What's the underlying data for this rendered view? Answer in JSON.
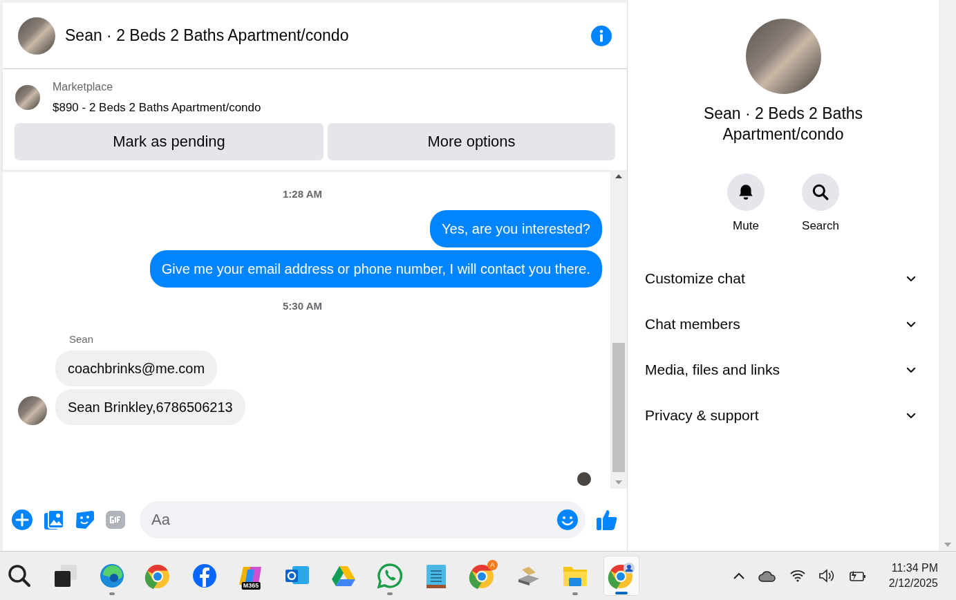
{
  "chat": {
    "title": "Sean · 2 Beds 2 Baths Apartment/condo",
    "listing": {
      "source": "Marketplace",
      "name": "$890 - 2 Beds 2 Baths Apartment/condo"
    },
    "actions": [
      "Mark as pending",
      "More options"
    ],
    "messages": [
      {
        "kind": "time",
        "text": "1:28 AM"
      },
      {
        "kind": "out",
        "text": "Yes, are you interested?"
      },
      {
        "kind": "out",
        "text": "Give me your email address or phone number, I will contact you there."
      },
      {
        "kind": "time",
        "text": "5:30 AM"
      },
      {
        "kind": "sender",
        "text": "Sean"
      },
      {
        "kind": "in",
        "text": "coachbrinks@me.com",
        "avatar": false
      },
      {
        "kind": "in",
        "text": "Sean Brinkley,6786506213",
        "avatar": true
      }
    ],
    "composer": {
      "placeholder": "Aa"
    }
  },
  "info": {
    "title": "Sean · 2 Beds 2 Baths Apartment/condo",
    "actions": [
      {
        "kind": "bell",
        "label": "Mute"
      },
      {
        "kind": "search",
        "label": "Search"
      }
    ],
    "sections": [
      {
        "label": "Customize chat",
        "expanded": false
      },
      {
        "label": "Chat members",
        "expanded": false
      },
      {
        "label": "Media, files and links",
        "expanded": false
      },
      {
        "label": "Privacy & support",
        "expanded": false
      }
    ]
  },
  "taskbar": {
    "apps": [
      {
        "kind": "search",
        "running": false,
        "selected": false
      },
      {
        "kind": "taskview",
        "running": false,
        "selected": false
      },
      {
        "kind": "edge",
        "running": true,
        "selected": false
      },
      {
        "kind": "chrome",
        "running": false,
        "selected": false
      },
      {
        "kind": "facebook",
        "running": false,
        "selected": false
      },
      {
        "kind": "copilot",
        "badge": "M365",
        "running": false,
        "selected": false
      },
      {
        "kind": "outlook",
        "running": false,
        "selected": false
      },
      {
        "kind": "drive",
        "running": false,
        "selected": false
      },
      {
        "kind": "whatsapp",
        "running": true,
        "selected": false
      },
      {
        "kind": "notepad",
        "running": false,
        "selected": false
      },
      {
        "kind": "chrome",
        "badge": "A",
        "running": false,
        "selected": false
      },
      {
        "kind": "drive-tool",
        "running": false,
        "selected": false
      },
      {
        "kind": "folder",
        "running": true,
        "selected": false
      },
      {
        "kind": "chrome-profile",
        "running": true,
        "selected": true
      }
    ],
    "clock": {
      "time": "11:34 PM",
      "date": "2/12/2025"
    }
  }
}
